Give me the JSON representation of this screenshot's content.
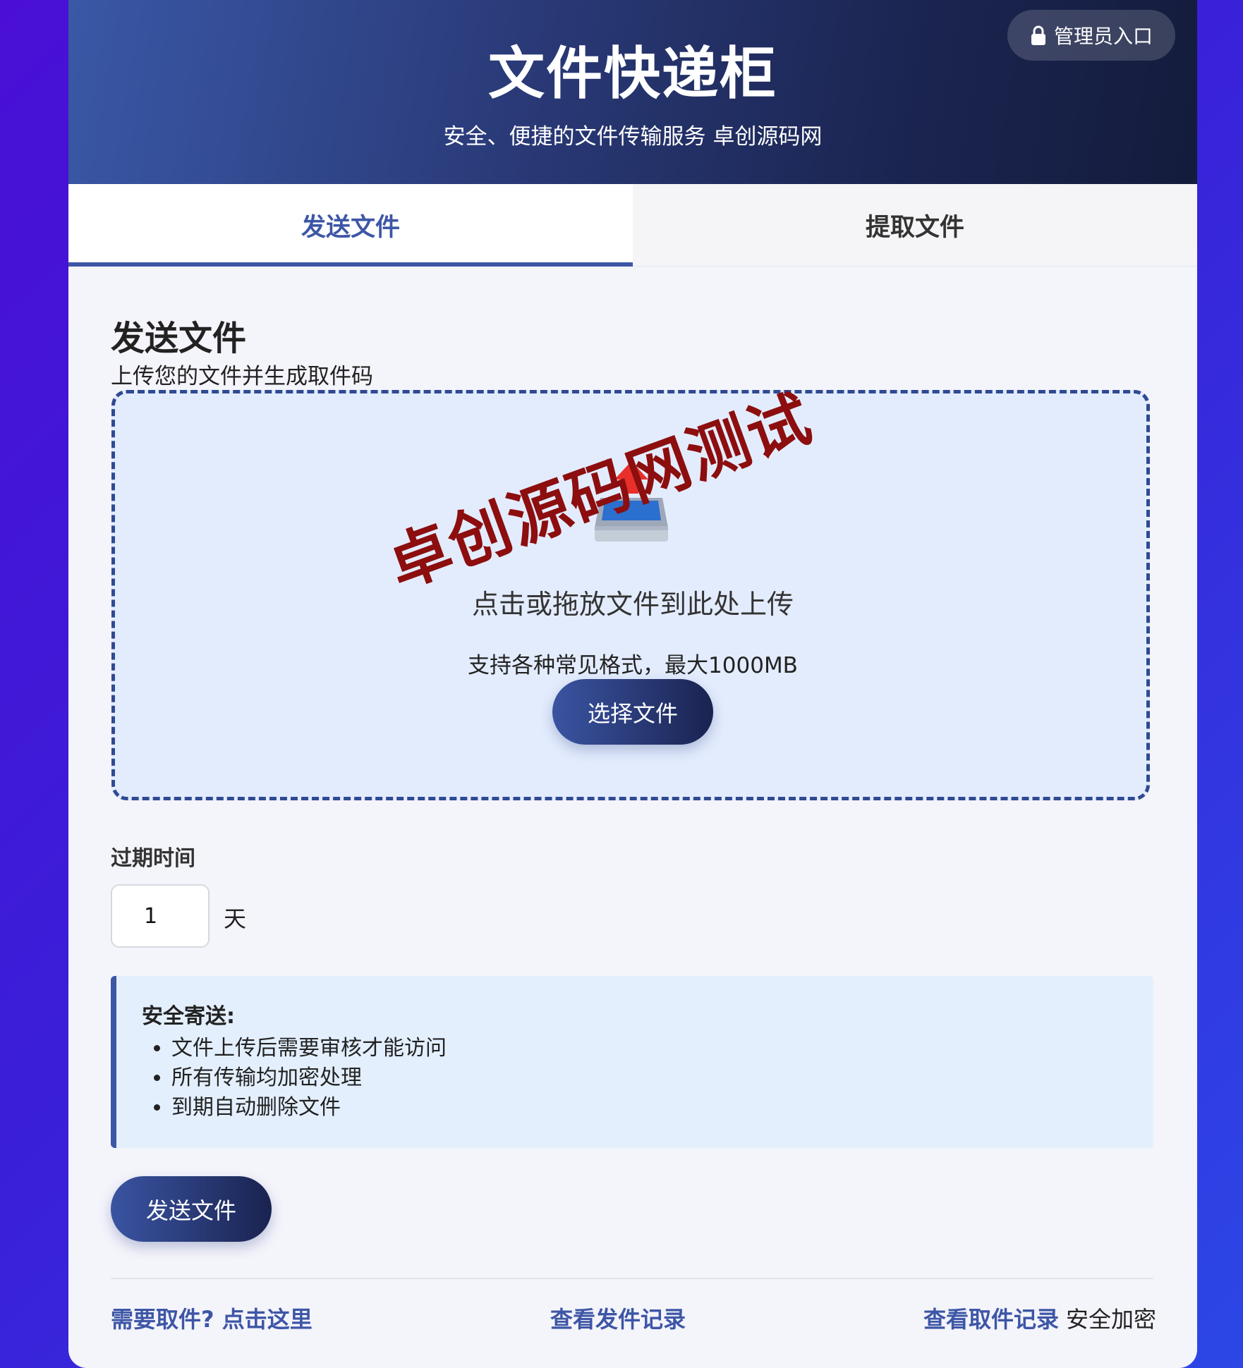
{
  "header": {
    "title": "文件快递柜",
    "subtitle": "安全、便捷的文件传输服务 卓创源码网",
    "admin_label": "管理员入口"
  },
  "tabs": [
    {
      "label": "发送文件",
      "active": true
    },
    {
      "label": "提取文件",
      "active": false
    }
  ],
  "send": {
    "title": "发送文件",
    "subtitle": "上传您的文件并生成取件码",
    "dropzone": {
      "main_text": "点击或拖放文件到此处上传",
      "hint": "支持各种常见格式，最大1000MB",
      "choose_label": "选择文件",
      "icon": "outbox-tray-icon"
    },
    "watermark": "卓创源码网测试",
    "expiry": {
      "label": "过期时间",
      "value": "1",
      "unit": "天"
    },
    "notice": {
      "title": "安全寄送:",
      "items": [
        "文件上传后需要审核才能访问",
        "所有传输均加密处理",
        "到期自动删除文件"
      ]
    },
    "submit_label": "发送文件"
  },
  "footer": {
    "pickup_link": "需要取件? 点击这里",
    "send_records": "查看发件记录",
    "pickup_records": "查看取件记录",
    "secure_text": "安全加密"
  },
  "colors": {
    "accent": "#3d56a6",
    "header_start": "#3a58a6",
    "header_end": "#141c3c",
    "watermark": "#8c0e0e"
  }
}
